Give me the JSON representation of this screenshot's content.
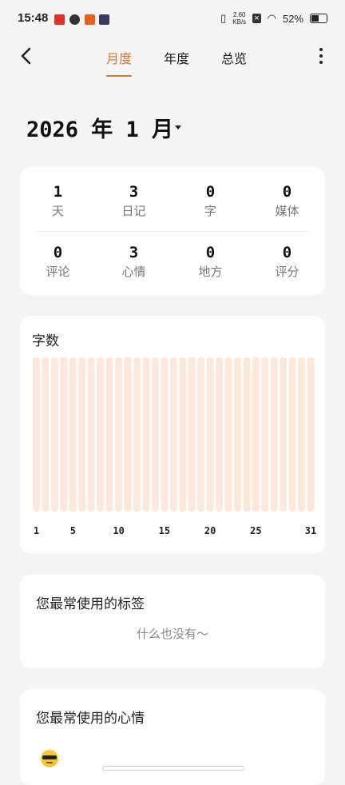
{
  "status_bar": {
    "time": "15:48",
    "net_speed_value": "2.60",
    "net_speed_unit": "KB/s",
    "battery": "52%"
  },
  "nav": {
    "tabs": [
      {
        "label": "月度",
        "active": true
      },
      {
        "label": "年度",
        "active": false
      },
      {
        "label": "总览",
        "active": false
      }
    ]
  },
  "period": {
    "title": "2026 年 1 月"
  },
  "stats": [
    {
      "value": "1",
      "label": "天"
    },
    {
      "value": "3",
      "label": "日记"
    },
    {
      "value": "0",
      "label": "字"
    },
    {
      "value": "0",
      "label": "媒体"
    },
    {
      "value": "0",
      "label": "评论"
    },
    {
      "value": "3",
      "label": "心情"
    },
    {
      "value": "0",
      "label": "地方"
    },
    {
      "value": "0",
      "label": "评分"
    }
  ],
  "chart_data": {
    "type": "bar",
    "title": "字数",
    "x": [
      1,
      2,
      3,
      4,
      5,
      6,
      7,
      8,
      9,
      10,
      11,
      12,
      13,
      14,
      15,
      16,
      17,
      18,
      19,
      20,
      21,
      22,
      23,
      24,
      25,
      26,
      27,
      28,
      29,
      30,
      31
    ],
    "values": [
      0,
      0,
      0,
      0,
      0,
      0,
      0,
      0,
      0,
      0,
      0,
      0,
      0,
      0,
      0,
      0,
      0,
      0,
      0,
      0,
      0,
      0,
      0,
      0,
      0,
      0,
      0,
      0,
      0,
      0,
      0
    ],
    "tick_labels": [
      "1",
      "5",
      "10",
      "15",
      "20",
      "25",
      "31"
    ],
    "bar_color": "#fde9dc"
  },
  "tags_section": {
    "title": "您最常使用的标签",
    "empty_text": "什么也没有～"
  },
  "moods_section": {
    "title": "您最常使用的心情",
    "top_mood_icon": "sunglasses-emoji-icon"
  },
  "colors": {
    "accent": "#e0762d",
    "bar": "#fde9dc",
    "background": "#f5f5f5"
  }
}
